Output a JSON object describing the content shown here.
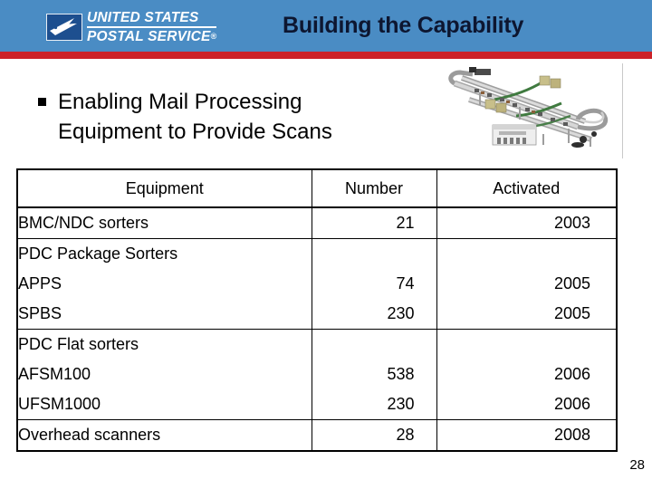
{
  "header": {
    "title": "Building the Capability",
    "band_color": "#4a8cc4",
    "rule_color": "#cc2229",
    "title_color": "#0d1630",
    "logo": {
      "mark_name": "usps-eagle-logo",
      "line1": "UNITED STATES",
      "line2": "POSTAL SERVICE",
      "registered_mark": "®"
    }
  },
  "body": {
    "bullet": {
      "marker": "square-bullet",
      "line1": "Enabling Mail Processing",
      "line2": "Equipment to Provide Scans"
    },
    "image": {
      "name": "mail-processing-equipment-photo",
      "alt": "3D rendering of an automated parcel sorting conveyor system"
    }
  },
  "table": {
    "columns": [
      "Equipment",
      "Number",
      "Activated"
    ],
    "rows": [
      {
        "equipment": [
          "BMC/NDC sorters"
        ],
        "number": [
          "21"
        ],
        "activated": [
          "2003"
        ]
      },
      {
        "equipment": [
          "PDC Package Sorters",
          "APPS",
          "SPBS"
        ],
        "number": [
          "",
          "74",
          "230"
        ],
        "activated": [
          "",
          "2005",
          "2005"
        ]
      },
      {
        "equipment": [
          "PDC Flat sorters",
          "AFSM100",
          "UFSM1000"
        ],
        "number": [
          "",
          "538",
          "230"
        ],
        "activated": [
          "",
          "2006",
          "2006"
        ]
      },
      {
        "equipment": [
          "Overhead scanners"
        ],
        "number": [
          "28"
        ],
        "activated": [
          "2008"
        ]
      }
    ]
  },
  "footer": {
    "page_number": "28"
  }
}
